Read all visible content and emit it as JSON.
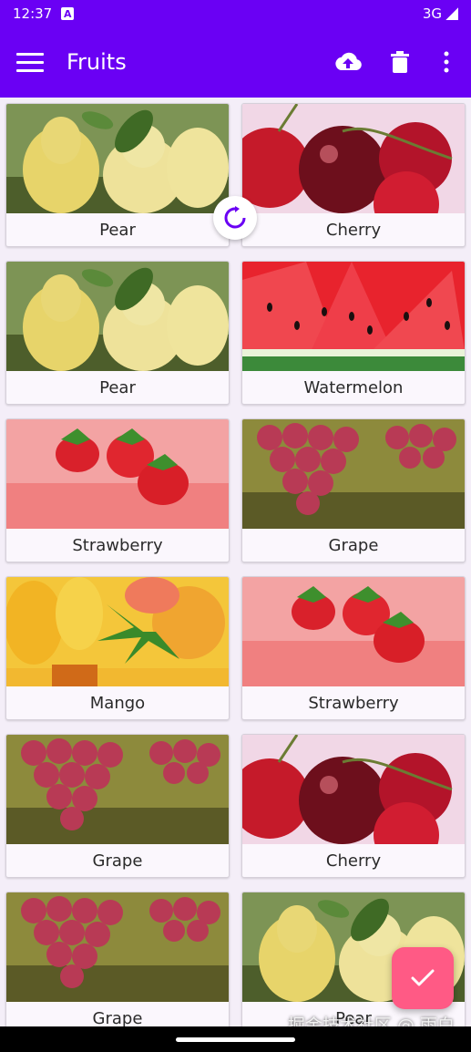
{
  "status": {
    "time": "12:37",
    "network": "3G",
    "indicator_letter": "A"
  },
  "toolbar": {
    "title": "Fruits",
    "icons": [
      "menu-icon",
      "upload-icon",
      "delete-icon",
      "more-icon"
    ],
    "color": "#6a00f4"
  },
  "fruits": [
    {
      "label": "Pear",
      "kind": "pear"
    },
    {
      "label": "Cherry",
      "kind": "cherry"
    },
    {
      "label": "Pear",
      "kind": "pear"
    },
    {
      "label": "Watermelon",
      "kind": "watermelon"
    },
    {
      "label": "Strawberry",
      "kind": "strawberry"
    },
    {
      "label": "Grape",
      "kind": "grape"
    },
    {
      "label": "Mango",
      "kind": "mango"
    },
    {
      "label": "Strawberry",
      "kind": "strawberry"
    },
    {
      "label": "Grape",
      "kind": "grape"
    },
    {
      "label": "Cherry",
      "kind": "cherry"
    },
    {
      "label": "Grape",
      "kind": "grape"
    },
    {
      "label": "Pear",
      "kind": "pear"
    }
  ],
  "fab": {
    "icon": "check-icon",
    "color": "#ff5a85"
  },
  "watermark": "掘金技术社区 @ 雨白"
}
